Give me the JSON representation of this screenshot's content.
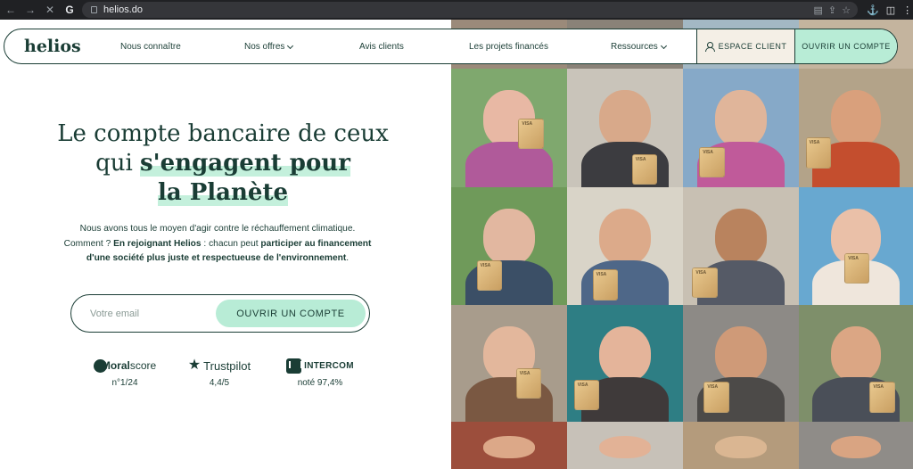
{
  "browser": {
    "url": "helios.do"
  },
  "header": {
    "logo": "helios",
    "nav": [
      {
        "label": "Nous connaître"
      },
      {
        "label": "Nos offres"
      },
      {
        "label": "Avis clients"
      },
      {
        "label": "Les projets financés"
      },
      {
        "label": "Ressources"
      }
    ],
    "espace_client": "ESPACE CLIENT",
    "open_account": "OUVRIR UN COMPTE"
  },
  "hero": {
    "title_part1": "Le compte bancaire de ceux qui ",
    "title_highlight1": "s'engagent pour",
    "title_highlight2": "la Planète",
    "text_1": "Nous avons tous le moyen d'agir contre le réchauffement climatique. Comment ? ",
    "text_bold_1": "En rejoignant Helios",
    "text_2": " : chacun peut ",
    "text_bold_2": "participer au financement d'une société plus juste et respectueuse de l'environnement",
    "text_3": "."
  },
  "signup": {
    "email_placeholder": "Votre email",
    "button": "OUVRIR UN COMPTE"
  },
  "ratings": [
    {
      "brand_o": "M",
      "brand_bold": "oral",
      "brand_rest": "score",
      "score": "n°1/24"
    },
    {
      "brand": "Trustpilot",
      "score": "4,4/5"
    },
    {
      "brand": "INTERCOM",
      "score": "noté 97,4%"
    }
  ],
  "colors": {
    "primary": "#1a3d35",
    "mint": "#b8ecd6",
    "cream": "#f4efe6"
  }
}
